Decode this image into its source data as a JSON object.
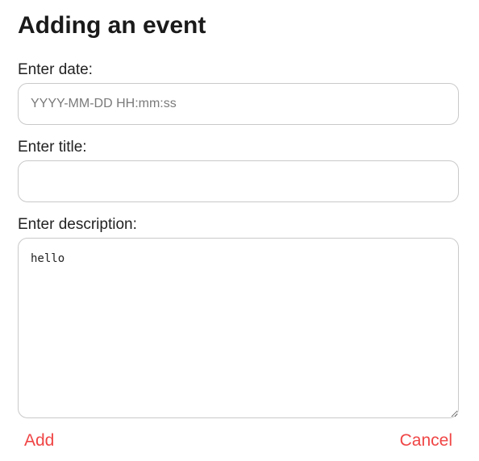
{
  "dialog": {
    "title": "Adding an event"
  },
  "date_field": {
    "label": "Enter date:",
    "value": "",
    "placeholder": "YYYY-MM-DD HH:mm:ss"
  },
  "title_field": {
    "label": "Enter title:",
    "value": "",
    "placeholder": ""
  },
  "description_field": {
    "label": "Enter description:",
    "value": "hello"
  },
  "actions": {
    "add_label": "Add",
    "cancel_label": "Cancel"
  },
  "colors": {
    "action": "#f04545",
    "border": "#c9c9c9",
    "title": "#1a1a1a"
  }
}
